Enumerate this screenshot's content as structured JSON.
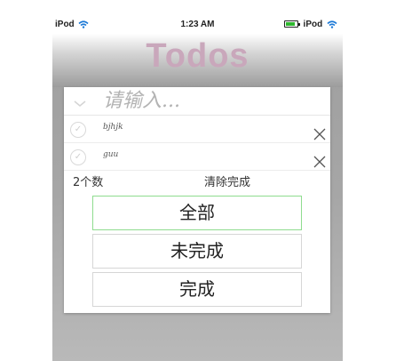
{
  "status_bar": {
    "left_carrier": "iPod",
    "time": "1:23 AM",
    "right_carrier": "iPod"
  },
  "app": {
    "title": "Todos",
    "title_color": "#c9a7bb"
  },
  "new_todo": {
    "placeholder": "请输入..."
  },
  "todos": [
    {
      "text": "bjhjk",
      "completed": false
    },
    {
      "text": "guu",
      "completed": false
    }
  ],
  "footer": {
    "count_label": "2个数",
    "clear_label": "清除完成"
  },
  "filters": [
    {
      "label": "全部",
      "selected": true
    },
    {
      "label": "未完成",
      "selected": false
    },
    {
      "label": "完成",
      "selected": false
    }
  ],
  "colors": {
    "active_filter_border": "#8fdc8f",
    "battery": "#2eb82e"
  }
}
